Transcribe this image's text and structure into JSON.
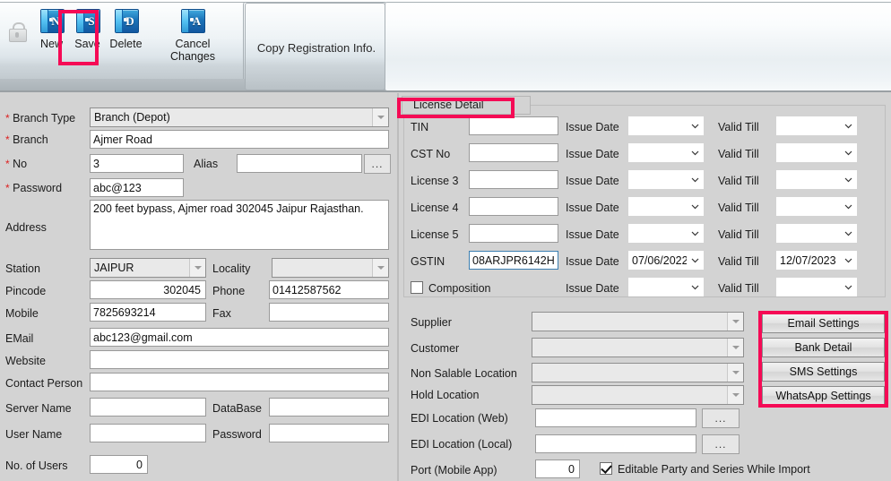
{
  "toolbar": {
    "lock_icon": "lock-icon",
    "buttons": [
      {
        "label": "New",
        "letter": "N",
        "icon": "new-document-icon"
      },
      {
        "label": "Save",
        "letter": "S",
        "icon": "save-document-icon"
      },
      {
        "label": "Delete",
        "letter": "D",
        "icon": "delete-document-icon"
      },
      {
        "label": "Cancel Changes",
        "letter": "A",
        "icon": "cancel-changes-icon"
      }
    ],
    "copy_registration": "Copy Registration Info."
  },
  "highlight_color": "#f50a55",
  "left_form": {
    "branch_type": {
      "label": "Branch Type",
      "required": true,
      "value": "Branch (Depot)"
    },
    "branch": {
      "label": "Branch",
      "required": true,
      "value": "Ajmer Road"
    },
    "no": {
      "label": "No",
      "required": true,
      "value": "3"
    },
    "alias": {
      "label": "Alias",
      "value": "",
      "browse": "..."
    },
    "password": {
      "label": "Password",
      "required": true,
      "value": "abc@123"
    },
    "address": {
      "label": "Address",
      "value": "200 feet bypass, Ajmer road 302045 Jaipur Rajasthan."
    },
    "station": {
      "label": "Station",
      "value": "JAIPUR"
    },
    "locality": {
      "label": "Locality",
      "value": ""
    },
    "pincode": {
      "label": "Pincode",
      "value": "302045"
    },
    "phone": {
      "label": "Phone",
      "value": "01412587562"
    },
    "mobile": {
      "label": "Mobile",
      "value": "7825693214"
    },
    "fax": {
      "label": "Fax",
      "value": ""
    },
    "email": {
      "label": "EMail",
      "value": "abc123@gmail.com"
    },
    "website": {
      "label": "Website",
      "value": ""
    },
    "contact_person": {
      "label": "Contact Person",
      "value": ""
    },
    "server_name": {
      "label": "Server Name",
      "value": ""
    },
    "database": {
      "label": "DataBase",
      "value": ""
    },
    "user_name": {
      "label": "User Name",
      "value": ""
    },
    "db_password": {
      "label": "Password",
      "value": ""
    },
    "no_of_users": {
      "label": "No. of Users",
      "value": "0"
    }
  },
  "license_detail": {
    "legend": "License Detail",
    "col_issue_date": "Issue Date",
    "col_valid_till": "Valid Till",
    "rows": [
      {
        "label": "TIN",
        "value": "",
        "issue_date": "",
        "valid_till": ""
      },
      {
        "label": "CST No",
        "value": "",
        "issue_date": "",
        "valid_till": ""
      },
      {
        "label": "License 3",
        "value": "",
        "issue_date": "",
        "valid_till": ""
      },
      {
        "label": "License 4",
        "value": "",
        "issue_date": "",
        "valid_till": ""
      },
      {
        "label": "License 5",
        "value": "",
        "issue_date": "",
        "valid_till": ""
      },
      {
        "label": "GSTIN",
        "value": "08ARJPR6142H",
        "issue_date": "07/06/2022",
        "valid_till": "12/07/2023"
      }
    ],
    "composition": {
      "label": "Composition",
      "checked": false,
      "issue_date": "",
      "valid_till": ""
    }
  },
  "locations": {
    "supplier": {
      "label": "Supplier",
      "value": ""
    },
    "customer": {
      "label": "Customer",
      "value": ""
    },
    "non_salable_location": {
      "label": "Non Salable Location",
      "value": ""
    },
    "hold_location": {
      "label": "Hold Location",
      "value": ""
    },
    "edi_web": {
      "label": "EDI Location (Web)",
      "value": "",
      "browse": "..."
    },
    "edi_local": {
      "label": "EDI Location (Local)",
      "value": "",
      "browse": "..."
    },
    "port_mobile_app": {
      "label": "Port (Mobile App)",
      "value": "0"
    },
    "editable_party": {
      "label": "Editable Party and Series While Import",
      "checked": true
    }
  },
  "settings_buttons": [
    {
      "label": "Email Settings"
    },
    {
      "label": "Bank Detail"
    },
    {
      "label": "SMS Settings"
    },
    {
      "label": "WhatsApp Settings"
    }
  ]
}
